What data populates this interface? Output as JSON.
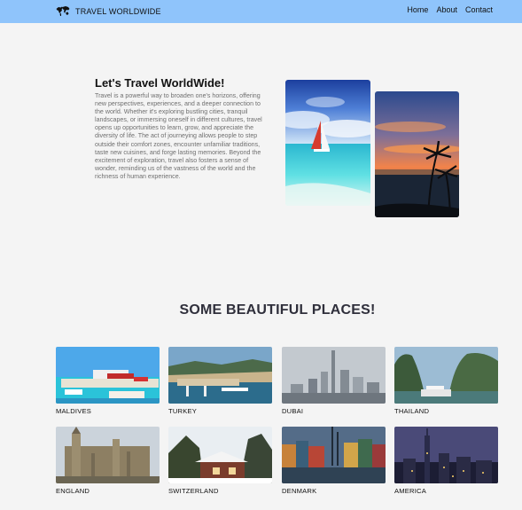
{
  "nav": {
    "brand": "TRAVEL WORLDWIDE",
    "brand_icon": "world-map-icon",
    "links": [
      "Home",
      "About",
      "Contact"
    ]
  },
  "hero": {
    "title": "Let's Travel WorldWide!",
    "text": "Travel is a powerful way to broaden one's horizons, offering new perspectives, experiences, and a deeper connection to the world. Whether it's exploring bustling cities, tranquil landscapes, or immersing oneself in different cultures, travel opens up opportunities to learn, grow, and appreciate the diversity of life. The act of journeying allows people to step outside their comfort zones, encounter unfamiliar traditions, taste new cuisines, and forge lasting memories. Beyond the excitement of exploration, travel also fosters a sense of wonder, reminding us of the vastness of the world and the richness of human experience."
  },
  "places": {
    "title": "SOME BEAUTIFUL PLACES!",
    "items": [
      "MALDIVES",
      "TURKEY",
      "DUBAI",
      "THAILAND",
      "ENGLAND",
      "SWITZERLAND",
      "DENMARK",
      "AMERICA"
    ]
  },
  "colors": {
    "navbar": "#8fc4fb",
    "background": "#f4f4f4",
    "section_title": "#2f2f3b"
  }
}
